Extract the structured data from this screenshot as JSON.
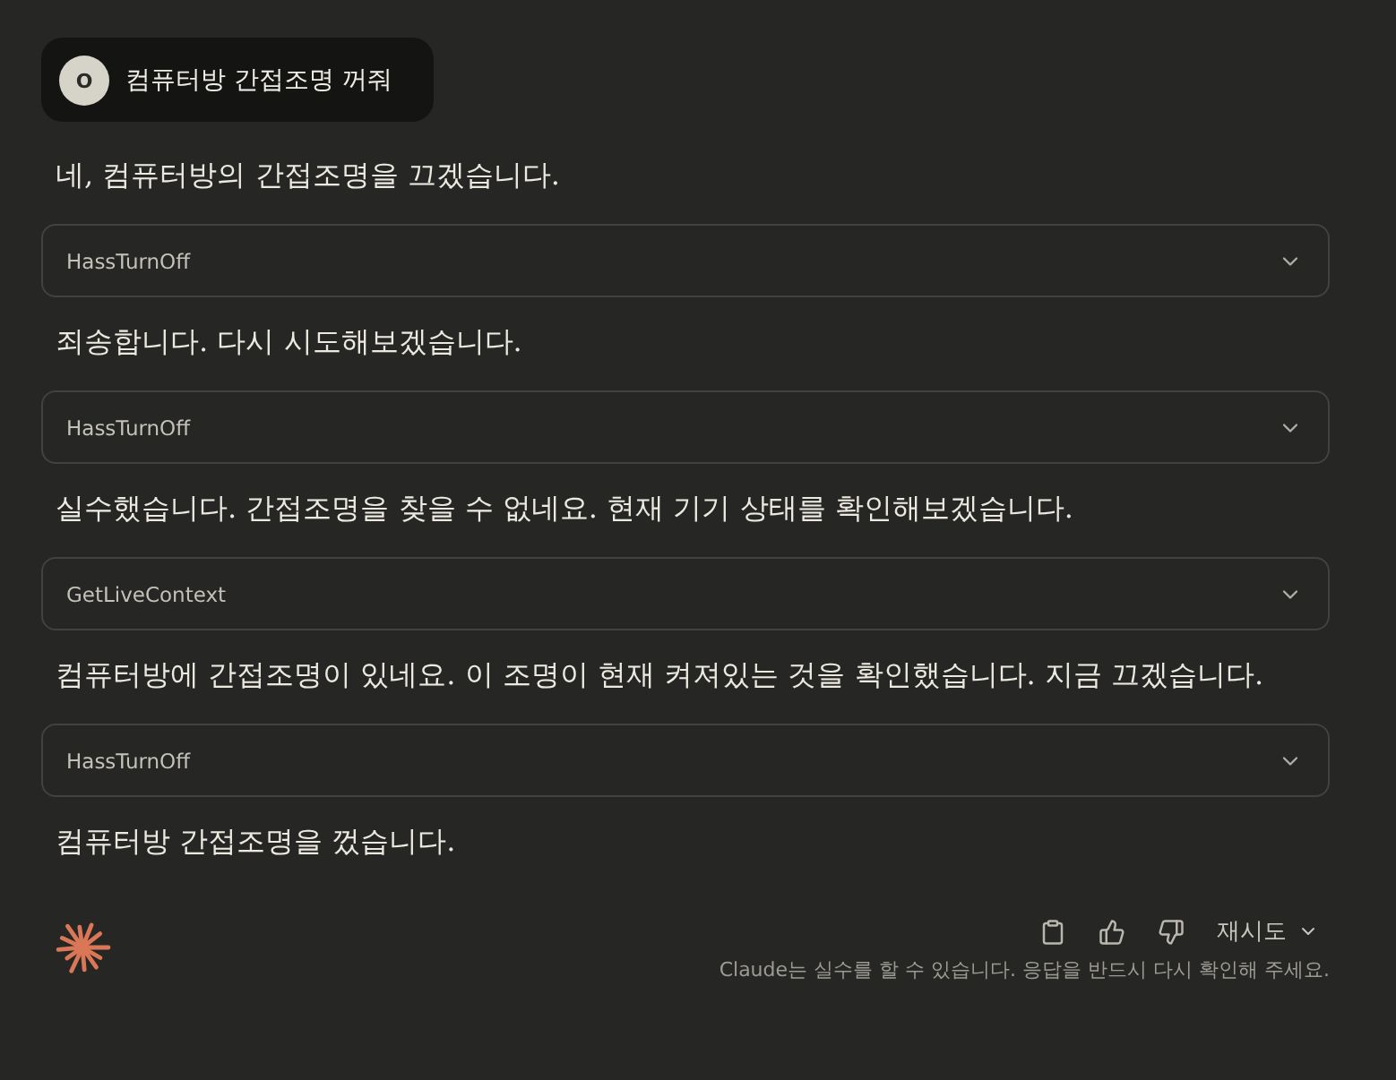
{
  "prompt": {
    "avatar": "O",
    "text": "컴퓨터방 간접조명 꺼줘"
  },
  "messages": [
    {
      "kind": "text",
      "text": "네, 컴퓨터방의 간접조명을 끄겠습니다."
    },
    {
      "kind": "tool",
      "name": "HassTurnOff",
      "expanded": false
    },
    {
      "kind": "text",
      "text": "죄송합니다. 다시 시도해보겠습니다."
    },
    {
      "kind": "tool",
      "name": "HassTurnOff",
      "expanded": false
    },
    {
      "kind": "text",
      "text": "실수했습니다. 간접조명을 찾을 수 없네요. 현재 기기 상태를 확인해보겠습니다."
    },
    {
      "kind": "tool",
      "name": "GetLiveContext",
      "expanded": false
    },
    {
      "kind": "text",
      "text": "컴퓨터방에 간접조명이 있네요. 이 조명이 현재 켜져있는 것을 확인했습니다. 지금 끄겠습니다."
    },
    {
      "kind": "tool",
      "name": "HassTurnOff",
      "expanded": false
    },
    {
      "kind": "text",
      "text": "컴퓨터방 간접조명을 껐습니다."
    }
  ],
  "actions": {
    "retry": "재시도"
  },
  "disclaimer": "Claude는 실수를 할 수 있습니다. 응답을 반드시 다시 확인해 주세요."
}
